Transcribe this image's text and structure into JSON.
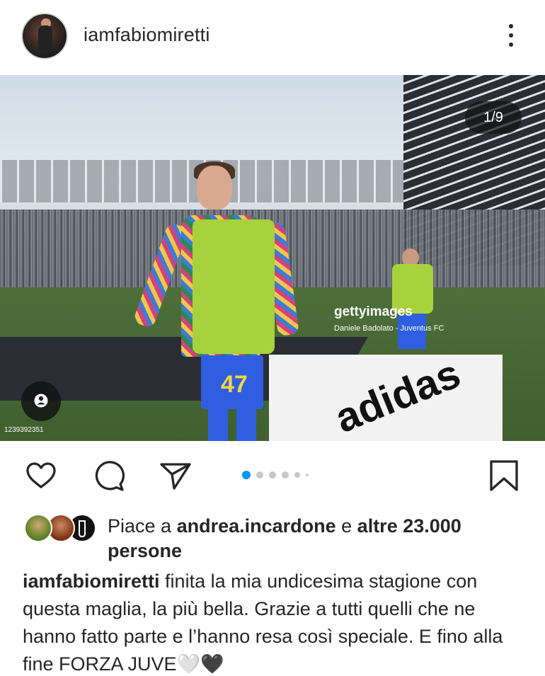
{
  "post": {
    "username": "iamfabiomiretti",
    "carousel": {
      "position_label": "1/9",
      "current": 1,
      "total": 9
    },
    "photo": {
      "watermark": "gettyimages",
      "credit": "Daniele Badolato - Juventus FC",
      "image_id": "1239392351",
      "jersey_number": "47",
      "ad_text": "adidas"
    }
  },
  "likes": {
    "prefix": "Piace a ",
    "user": "andrea.incardone",
    "middle": " e ",
    "others": "altre 23.000",
    "suffix": "persone"
  },
  "caption": {
    "author": "iamfabiomiretti",
    "text": " finita la mia undicesima stagione con questa maglia, la più bella. Grazie a tutti quelli che ne hanno fatto parte e l’hanno resa così speciale. E fino alla fine FORZA JUVE",
    "emoji_1": "🤍",
    "emoji_2": "🖤"
  },
  "icons": {
    "more": "more-options-icon",
    "like": "heart-icon",
    "comment": "comment-icon",
    "share": "send-icon",
    "save": "bookmark-icon",
    "tags": "person-tag-icon"
  },
  "colors": {
    "text": "#262626",
    "active_dot": "#0095f6",
    "inactive_dot": "#c7c7c7",
    "counter_bg": "#121212"
  }
}
